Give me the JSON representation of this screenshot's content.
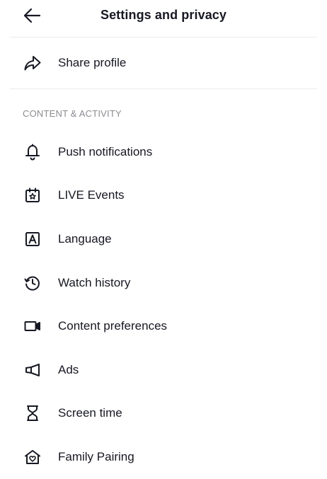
{
  "header": {
    "title": "Settings and privacy",
    "back_icon": "arrow-left-icon"
  },
  "share": {
    "label": "Share profile",
    "icon": "share-arrow-icon"
  },
  "section": {
    "title": "CONTENT & ACTIVITY",
    "items": [
      {
        "label": "Push notifications",
        "icon": "bell-icon"
      },
      {
        "label": "LIVE Events",
        "icon": "calendar-star-icon"
      },
      {
        "label": "Language",
        "icon": "language-a-icon"
      },
      {
        "label": "Watch history",
        "icon": "history-clock-icon"
      },
      {
        "label": "Content preferences",
        "icon": "video-camera-icon"
      },
      {
        "label": "Ads",
        "icon": "megaphone-icon"
      },
      {
        "label": "Screen time",
        "icon": "hourglass-icon"
      },
      {
        "label": "Family Pairing",
        "icon": "family-home-heart-icon"
      }
    ]
  }
}
